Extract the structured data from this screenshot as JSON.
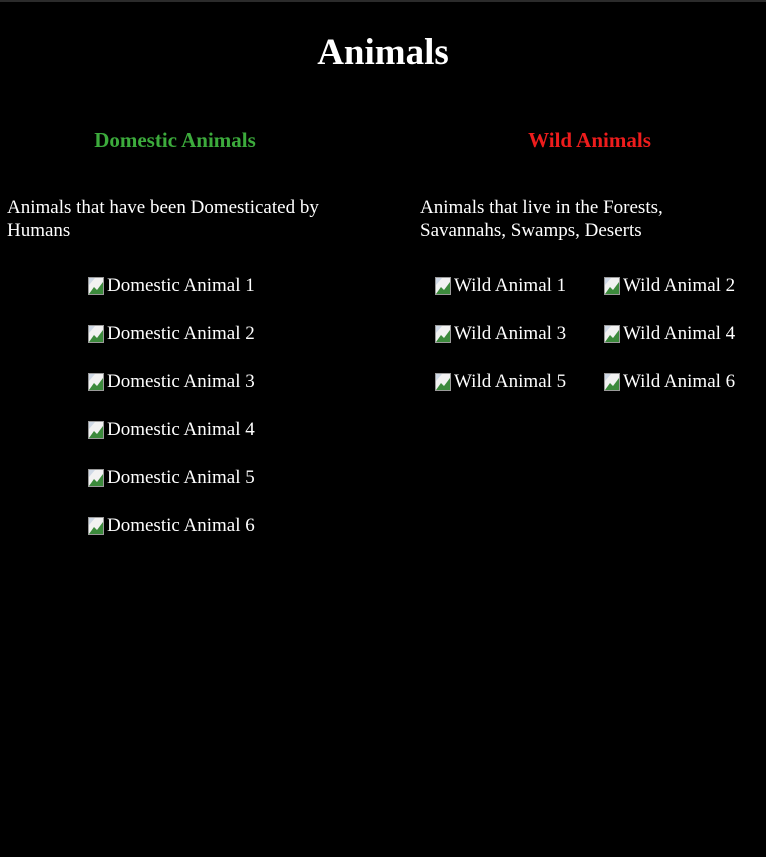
{
  "page": {
    "title": "Animals"
  },
  "colors": {
    "background": "#000000",
    "text": "#ffffff",
    "domestic_heading": "#3cab3c",
    "wild_heading": "#ee1c1c"
  },
  "domestic": {
    "heading": "Domestic Animals",
    "description": "Animals that have been Domesticated by Humans",
    "images": [
      {
        "alt": "Domestic Animal 1"
      },
      {
        "alt": "Domestic Animal 2"
      },
      {
        "alt": "Domestic Animal 3"
      },
      {
        "alt": "Domestic Animal 4"
      },
      {
        "alt": "Domestic Animal 5"
      },
      {
        "alt": "Domestic Animal 6"
      }
    ]
  },
  "wild": {
    "heading": "Wild Animals",
    "description": "Animals that live in the Forests, Savannahs, Swamps, Deserts",
    "images": [
      {
        "alt": "Wild Animal 1"
      },
      {
        "alt": "Wild Animal 2"
      },
      {
        "alt": "Wild Animal 3"
      },
      {
        "alt": "Wild Animal 4"
      },
      {
        "alt": "Wild Animal 5"
      },
      {
        "alt": "Wild Animal 6"
      }
    ]
  }
}
